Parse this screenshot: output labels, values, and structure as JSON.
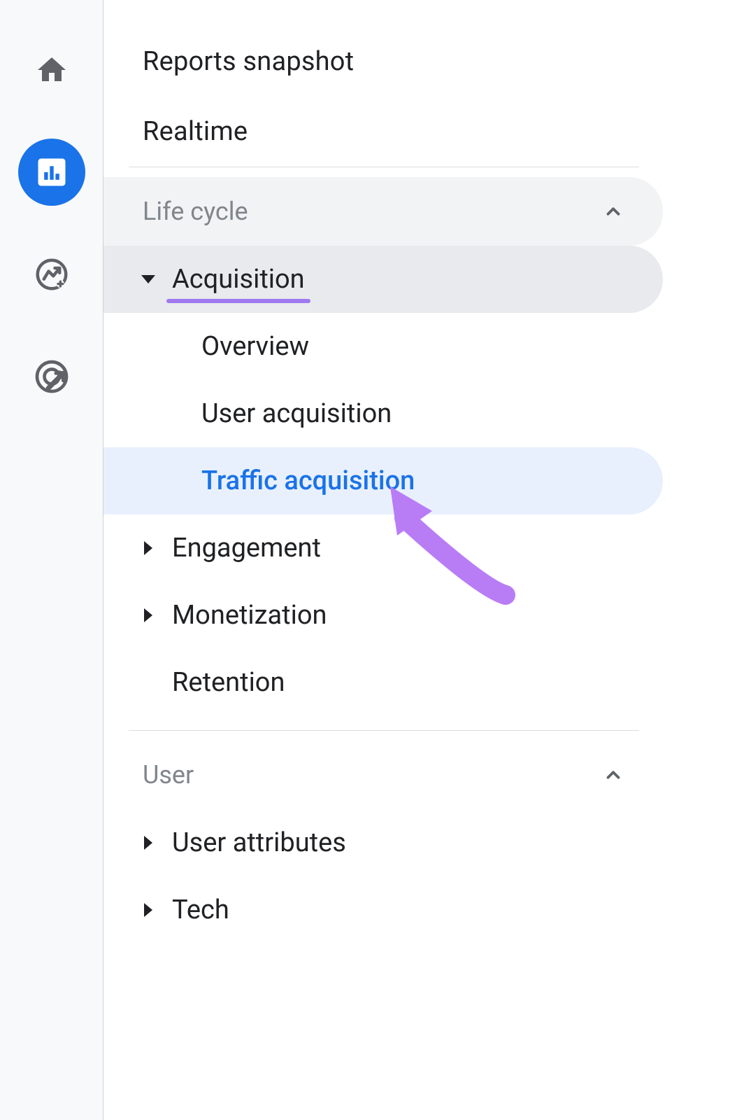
{
  "colors": {
    "accent": "#1a73e8",
    "underline": "#a078f0",
    "arrow": "#b87df5",
    "muted": "#80868b",
    "text": "#202124"
  },
  "rail": [
    {
      "name": "home-icon",
      "active": false
    },
    {
      "name": "reports-icon",
      "active": true
    },
    {
      "name": "explore-icon",
      "active": false
    },
    {
      "name": "advertising-icon",
      "active": false
    }
  ],
  "top_links": [
    {
      "label": "Reports snapshot"
    },
    {
      "label": "Realtime"
    }
  ],
  "sections": [
    {
      "label": "Life cycle",
      "expanded": true,
      "categories": [
        {
          "label": "Acquisition",
          "expanded": true,
          "underlined": true,
          "children": [
            {
              "label": "Overview",
              "selected": false
            },
            {
              "label": "User acquisition",
              "selected": false
            },
            {
              "label": "Traffic acquisition",
              "selected": true
            }
          ]
        },
        {
          "label": "Engagement",
          "expanded": false,
          "children": []
        },
        {
          "label": "Monetization",
          "expanded": false,
          "children": []
        },
        {
          "label": "Retention",
          "expanded": false,
          "no_arrow": true,
          "children": []
        }
      ]
    },
    {
      "label": "User",
      "expanded": true,
      "categories": [
        {
          "label": "User attributes",
          "expanded": false,
          "children": []
        },
        {
          "label": "Tech",
          "expanded": false,
          "children": []
        }
      ]
    }
  ]
}
